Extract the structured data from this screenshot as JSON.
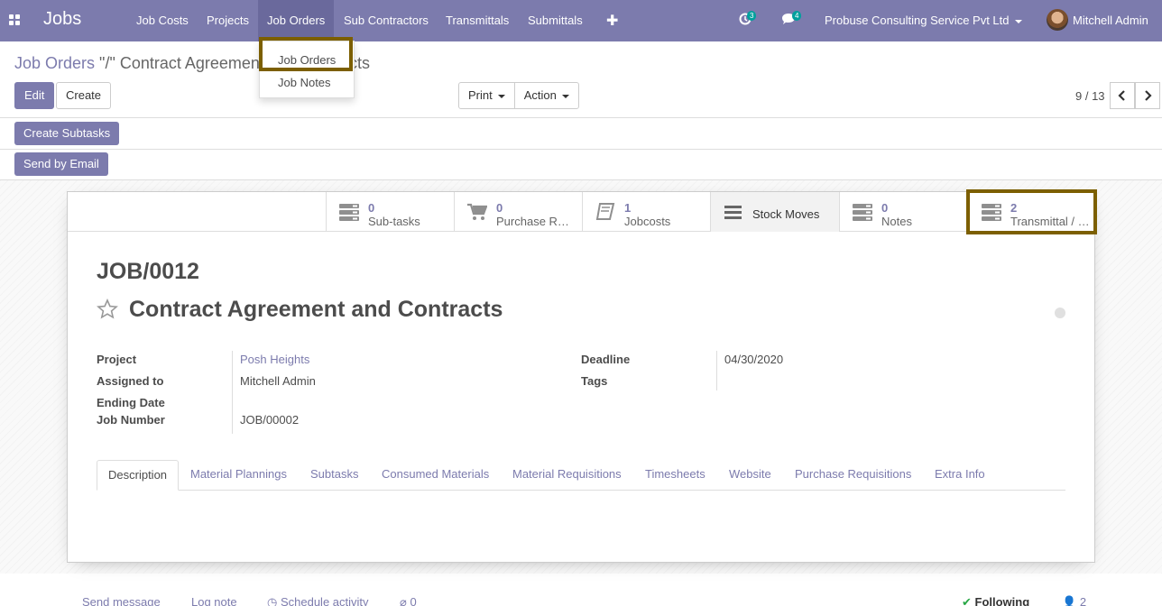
{
  "navbar": {
    "brand": "Jobs",
    "menus": [
      "Job Costs",
      "Projects",
      "Job Orders",
      "Sub Contractors",
      "Transmittals",
      "Submittals"
    ],
    "activities_count": "3",
    "messages_count": "4",
    "company": "Probuse Consulting Service Pvt Ltd",
    "user": "Mitchell Admin",
    "accent_color": "#7c7bad"
  },
  "dropdown": {
    "items": [
      "Job Orders",
      "Job Notes"
    ]
  },
  "breadcrumb": {
    "parent": "Job Orders",
    "current": " \"/\" Contract Agreement and Contracts"
  },
  "controls": {
    "edit": "Edit",
    "create": "Create",
    "print": "Print",
    "action": "Action",
    "pager": "9 / 13"
  },
  "statusbar": {
    "create_subtasks": "Create Subtasks",
    "send_by_email": "Send by Email"
  },
  "smart_buttons": [
    {
      "count": "0",
      "label": "Sub-tasks",
      "icon": "list-icon"
    },
    {
      "count": "0",
      "label": "Purchase R…",
      "icon": "cart-icon"
    },
    {
      "count": "1",
      "label": "Jobcosts",
      "icon": "book-icon"
    },
    {
      "count": "",
      "label": "Stock Moves",
      "icon": "bars-icon"
    },
    {
      "count": "0",
      "label": "Notes",
      "icon": "list-icon"
    },
    {
      "count": "2",
      "label": "Transmittal / …",
      "icon": "list-icon"
    }
  ],
  "record": {
    "reference": "JOB/0012",
    "name": "Contract Agreement and Contracts"
  },
  "fields": {
    "project_label": "Project",
    "project": "Posh Heights",
    "assigned_label": "Assigned to",
    "assigned": "Mitchell Admin",
    "ending_label": "Ending Date",
    "ending": "",
    "jobnum_label": "Job Number",
    "jobnum": "JOB/00002",
    "deadline_label": "Deadline",
    "deadline": "04/30/2020",
    "tags_label": "Tags",
    "tags": ""
  },
  "tabs": [
    "Description",
    "Material Plannings",
    "Subtasks",
    "Consumed Materials",
    "Material Requisitions",
    "Timesheets",
    "Website",
    "Purchase Requisitions",
    "Extra Info"
  ],
  "chatter": {
    "send_message": "Send message",
    "log_note": "Log note",
    "schedule": "Schedule activity",
    "attachments": "0",
    "following": "Following",
    "followers": "2"
  }
}
